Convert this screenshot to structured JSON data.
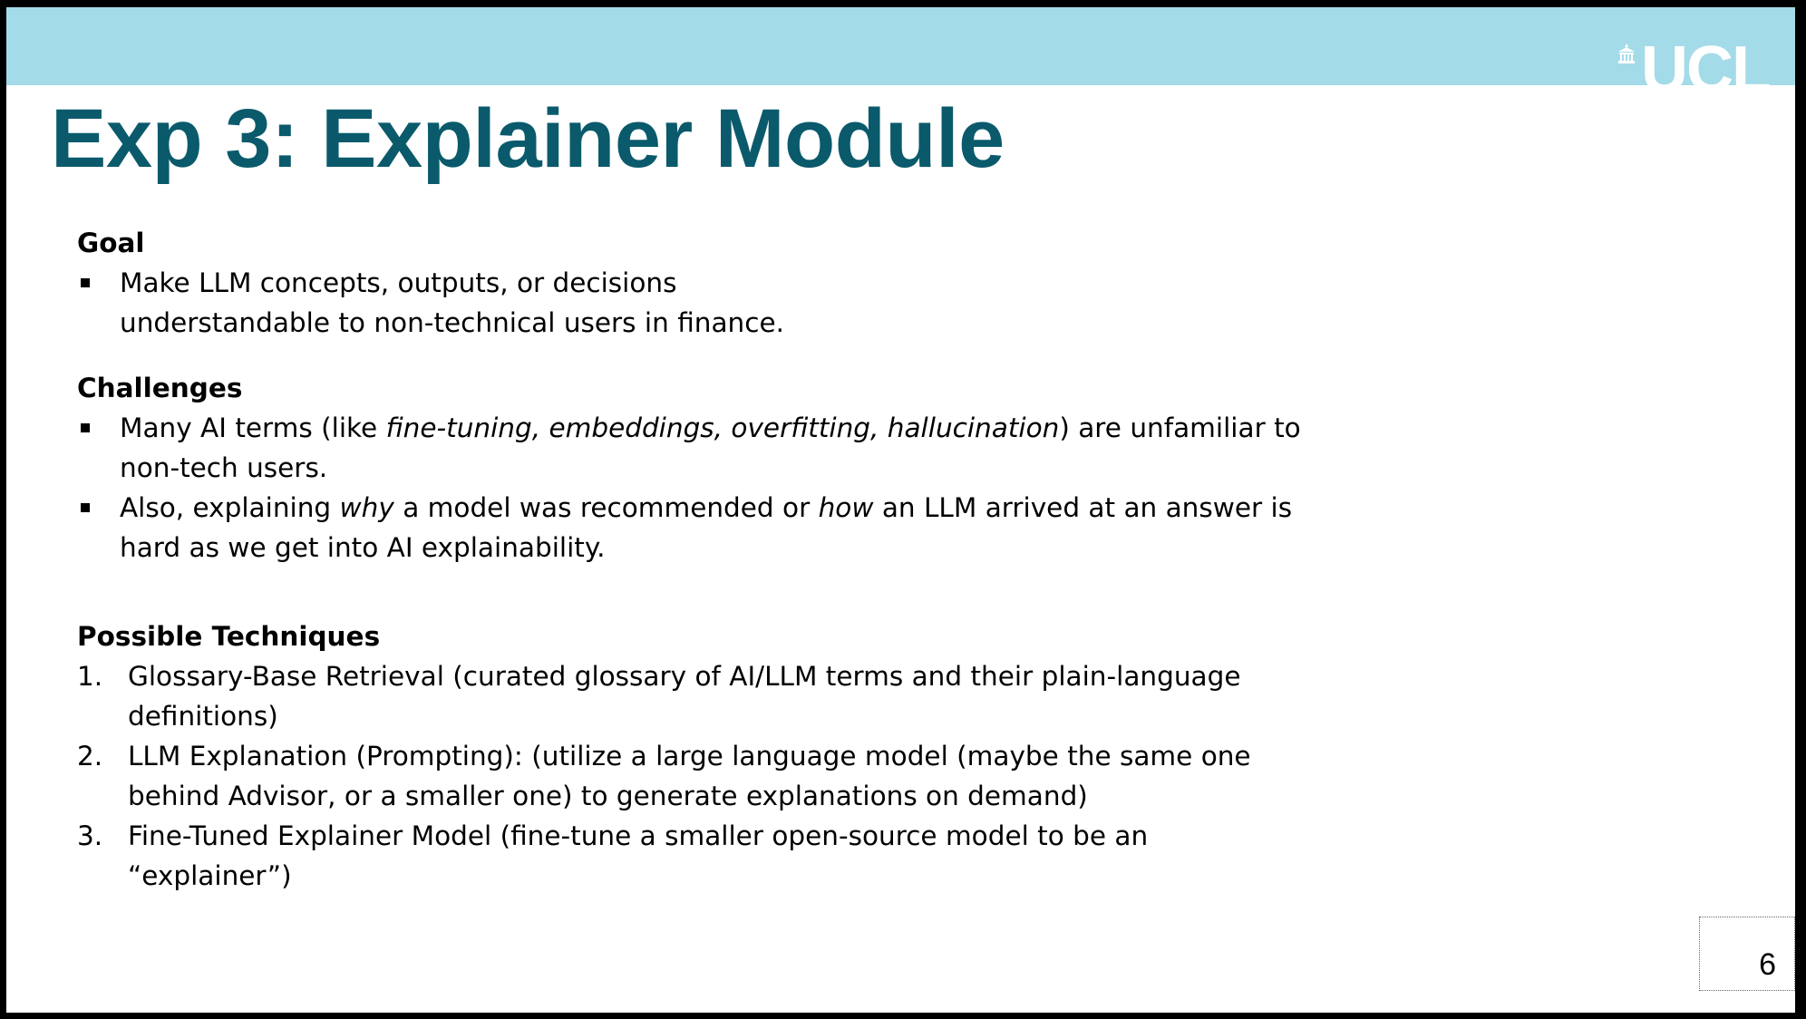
{
  "logo_text": "UCL",
  "title": "Exp 3: Explainer Module",
  "goal": {
    "heading": "Goal",
    "bullet": "Make LLM concepts, outputs, or decisions understandable to non-technical users in finance."
  },
  "challenges": {
    "heading": "Challenges",
    "bullet1": {
      "prefix": "Many AI terms (like ",
      "italic": "fine-tuning, embeddings, overfitting, hallucination",
      "suffix": ") are unfamiliar to non-tech users."
    },
    "bullet2": {
      "part1": "Also, explaining ",
      "italic1": "why",
      "part2": " a model was recommended or ",
      "italic2": "how",
      "part3": " an LLM arrived at an answer is hard as we get into AI explainability."
    }
  },
  "techniques": {
    "heading": "Possible Techniques",
    "items": [
      {
        "num": "1.",
        "text": "Glossary-Base Retrieval (curated glossary of AI/LLM terms and their plain-language definitions)"
      },
      {
        "num": "2.",
        "text": "LLM Explanation (Prompting): (utilize a large language model (maybe the same one behind Advisor, or a smaller one) to generate explanations on demand)"
      },
      {
        "num": "3.",
        "text": "Fine-Tuned Explainer Model (fine-tune a smaller open-source model to be an “explainer”)"
      }
    ]
  },
  "slide_number": "6",
  "colors": {
    "top_bar": "#a4dbe8",
    "title": "#0a5a6c",
    "logo": "#ffffff"
  }
}
